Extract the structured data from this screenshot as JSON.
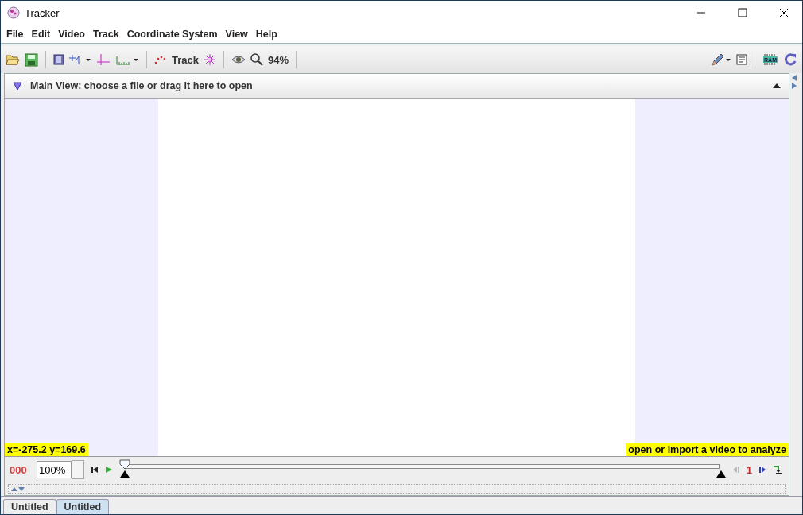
{
  "window": {
    "title": "Tracker"
  },
  "menu": [
    "File",
    "Edit",
    "Video",
    "Track",
    "Coordinate System",
    "View",
    "Help"
  ],
  "toolbar": {
    "track_label": "Track",
    "zoom": "94%",
    "memory_label": "RAM"
  },
  "main_view": {
    "title": "Main View: choose a file or drag it here to open",
    "coordinates": "x=-275.2  y=169.6",
    "hint": "open or import a video to analyze"
  },
  "player": {
    "frame": "000",
    "rate": "100%",
    "step": "1",
    "level": 0.0
  },
  "tabs": [
    {
      "label": "Untitled",
      "selected": false
    },
    {
      "label": "Untitled",
      "selected": true
    }
  ]
}
